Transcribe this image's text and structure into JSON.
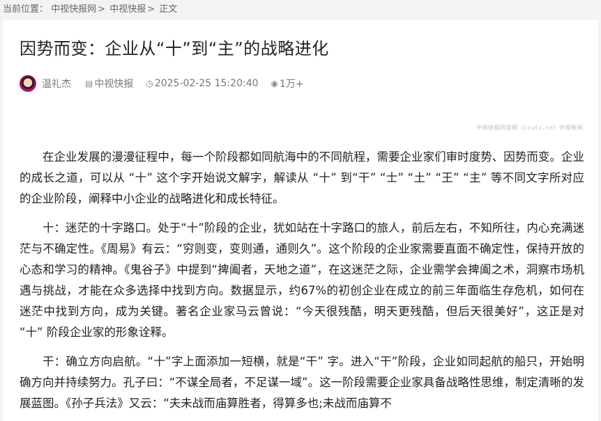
{
  "breadcrumb": {
    "label": "当前位置：",
    "items": [
      "中视快报网",
      "中视快报",
      "正文"
    ]
  },
  "article": {
    "title": "因势而变：企业从“十”到“主”的战略进化",
    "author": "温礼杰",
    "channel": "中视快报",
    "date": "2025-02-25 15:20:40",
    "views": "1万+",
    "source_note": "中视快报网官网（ccutv.cn）中视新闻",
    "paragraphs": [
      "在企业发展的漫漫征程中，每一个阶段都如同航海中的不同航程，需要企业家们审时度势、因势而变。企业的成长之道，可以从 “十” 这个字开始说文解字，解读从 “十” 到“干” “士” “土” “王” “主” 等不同文字所对应的企业阶段，阐释中小企业的战略进化和成长特征。",
      "十：迷茫的十字路口。处于“十”阶段的企业，犹如站在十字路口的旅人，前后左右，不知所往，内心充满迷茫与不确定性。《周易》有云：“穷则变，变则通，通则久”。这个阶段的企业家需要直面不确定性，保持开放的心态和学习的精神。《鬼谷子》中提到“捭阖者，天地之道”，在这迷茫之际，企业需学会捭阖之术，洞察市场机遇与挑战，才能在众多选择中找到方向。数据显示，约67%的初创企业在成立的前三年面临生存危机，如何在迷茫中找到方向，成为关键。著名企业家马云曾说：“今天很残酷，明天更残酷，但后天很美好”，这正是对 “十” 阶段企业家的形象诠释。",
      "干：确立方向启航。“十”字上面添加一短横，就是“干” 字。进入“干”阶段，企业如同起航的船只，开始明确方向并持续努力。孔子曰：“不谋全局者，不足谋一域”。这一阶段需要企业家具备战略性思维，制定清晰的发展蓝图。《孙子兵法》又云：“夫未战而庙算胜者，得算多也;未战而庙算不"
    ]
  }
}
